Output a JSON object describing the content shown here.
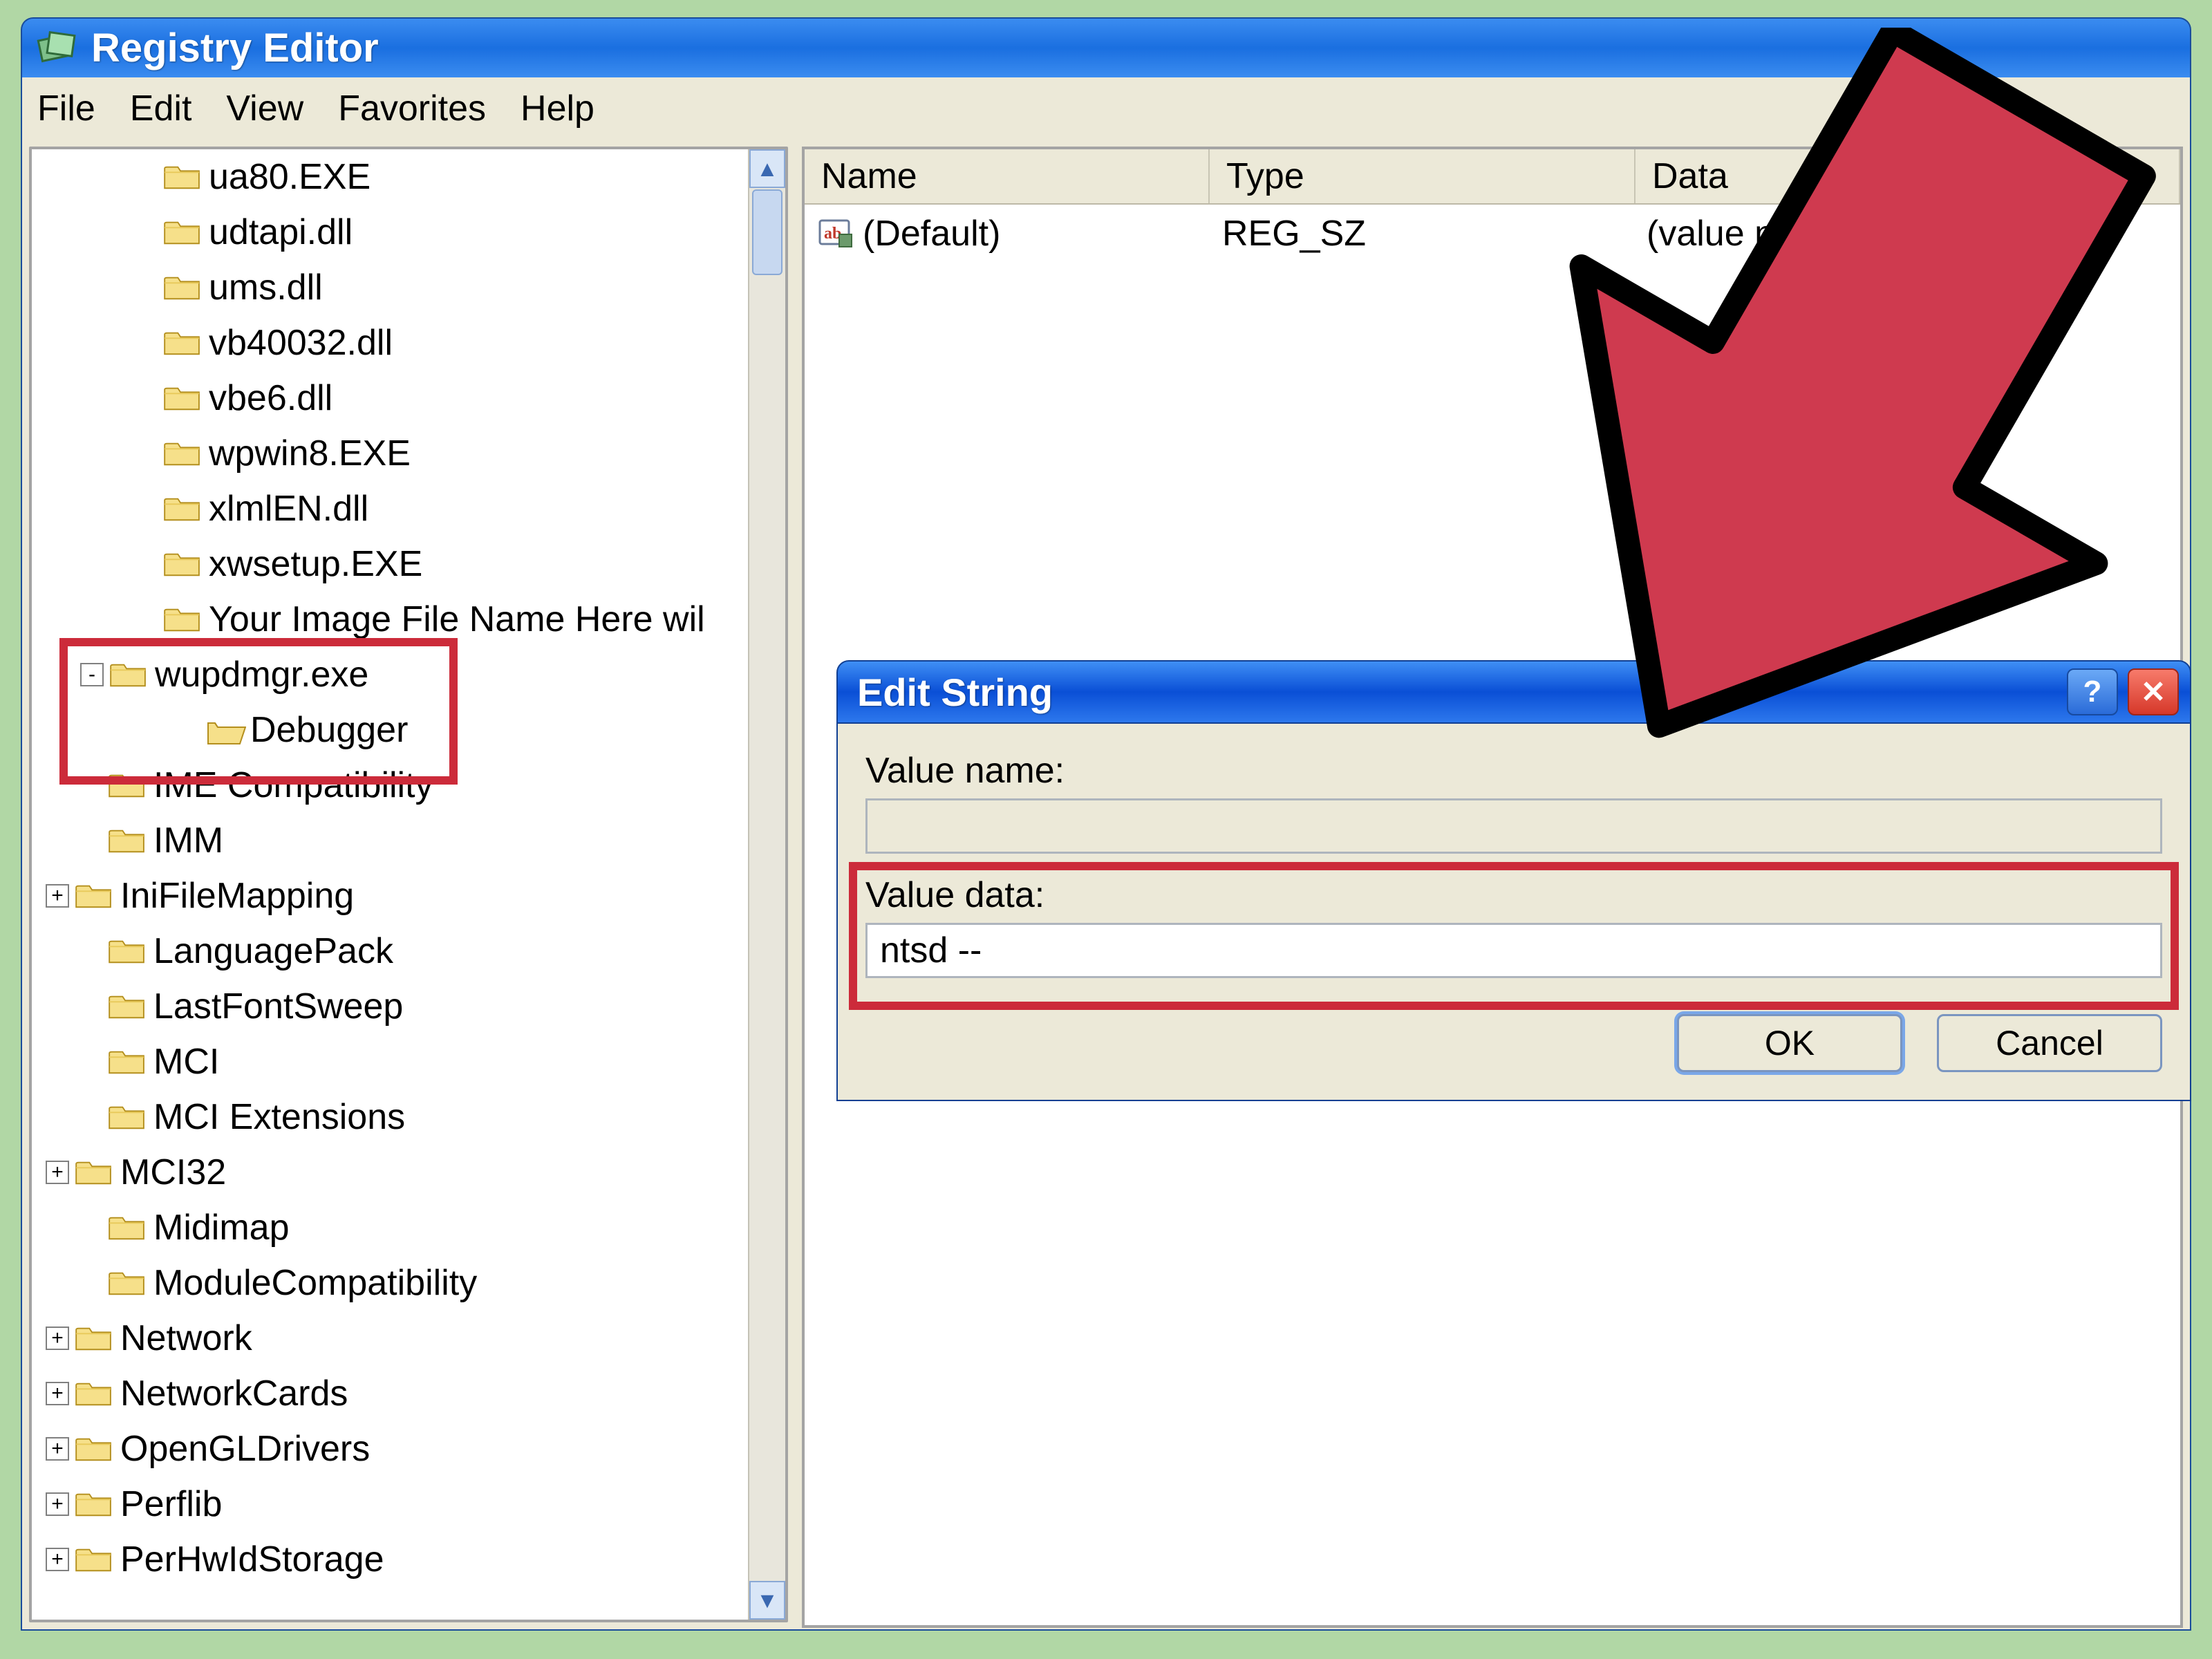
{
  "window": {
    "title": "Registry Editor"
  },
  "menu": {
    "items": [
      "File",
      "Edit",
      "View",
      "Favorites",
      "Help"
    ]
  },
  "tree": {
    "items": [
      {
        "indent": 140,
        "pm": null,
        "label": "ua80.EXE",
        "open": false
      },
      {
        "indent": 140,
        "pm": null,
        "label": "udtapi.dll",
        "open": false
      },
      {
        "indent": 140,
        "pm": null,
        "label": "ums.dll",
        "open": false
      },
      {
        "indent": 140,
        "pm": null,
        "label": "vb40032.dll",
        "open": false
      },
      {
        "indent": 140,
        "pm": null,
        "label": "vbe6.dll",
        "open": false
      },
      {
        "indent": 140,
        "pm": null,
        "label": "wpwin8.EXE",
        "open": false
      },
      {
        "indent": 140,
        "pm": null,
        "label": "xlmlEN.dll",
        "open": false
      },
      {
        "indent": 140,
        "pm": null,
        "label": "xwsetup.EXE",
        "open": false
      },
      {
        "indent": 140,
        "pm": null,
        "label": "Your Image File Name Here wil",
        "open": false
      },
      {
        "indent": 60,
        "pm": "-",
        "label": "wupdmgr.exe",
        "open": false
      },
      {
        "indent": 200,
        "pm": null,
        "label": "Debugger",
        "open": true
      },
      {
        "indent": 60,
        "pm": null,
        "label": "IME Compatibility",
        "open": false
      },
      {
        "indent": 60,
        "pm": null,
        "label": "IMM",
        "open": false
      },
      {
        "indent": 10,
        "pm": "+",
        "label": "IniFileMapping",
        "open": false
      },
      {
        "indent": 60,
        "pm": null,
        "label": "LanguagePack",
        "open": false
      },
      {
        "indent": 60,
        "pm": null,
        "label": "LastFontSweep",
        "open": false
      },
      {
        "indent": 60,
        "pm": null,
        "label": "MCI",
        "open": false
      },
      {
        "indent": 60,
        "pm": null,
        "label": "MCI Extensions",
        "open": false
      },
      {
        "indent": 10,
        "pm": "+",
        "label": "MCI32",
        "open": false
      },
      {
        "indent": 60,
        "pm": null,
        "label": "Midimap",
        "open": false
      },
      {
        "indent": 60,
        "pm": null,
        "label": "ModuleCompatibility",
        "open": false
      },
      {
        "indent": 10,
        "pm": "+",
        "label": "Network",
        "open": false
      },
      {
        "indent": 10,
        "pm": "+",
        "label": "NetworkCards",
        "open": false
      },
      {
        "indent": 10,
        "pm": "+",
        "label": "OpenGLDrivers",
        "open": false
      },
      {
        "indent": 10,
        "pm": "+",
        "label": "Perflib",
        "open": false
      },
      {
        "indent": 10,
        "pm": "+",
        "label": "PerHwIdStorage",
        "open": false
      }
    ]
  },
  "list": {
    "columns": [
      "Name",
      "Type",
      "Data"
    ],
    "rows": [
      {
        "name": "(Default)",
        "type": "REG_SZ",
        "data": "(value not set)"
      }
    ]
  },
  "dialog": {
    "title": "Edit String",
    "value_name_label": "Value name:",
    "value_name": "",
    "value_data_label": "Value data:",
    "value_data": "ntsd --",
    "ok": "OK",
    "cancel": "Cancel"
  }
}
